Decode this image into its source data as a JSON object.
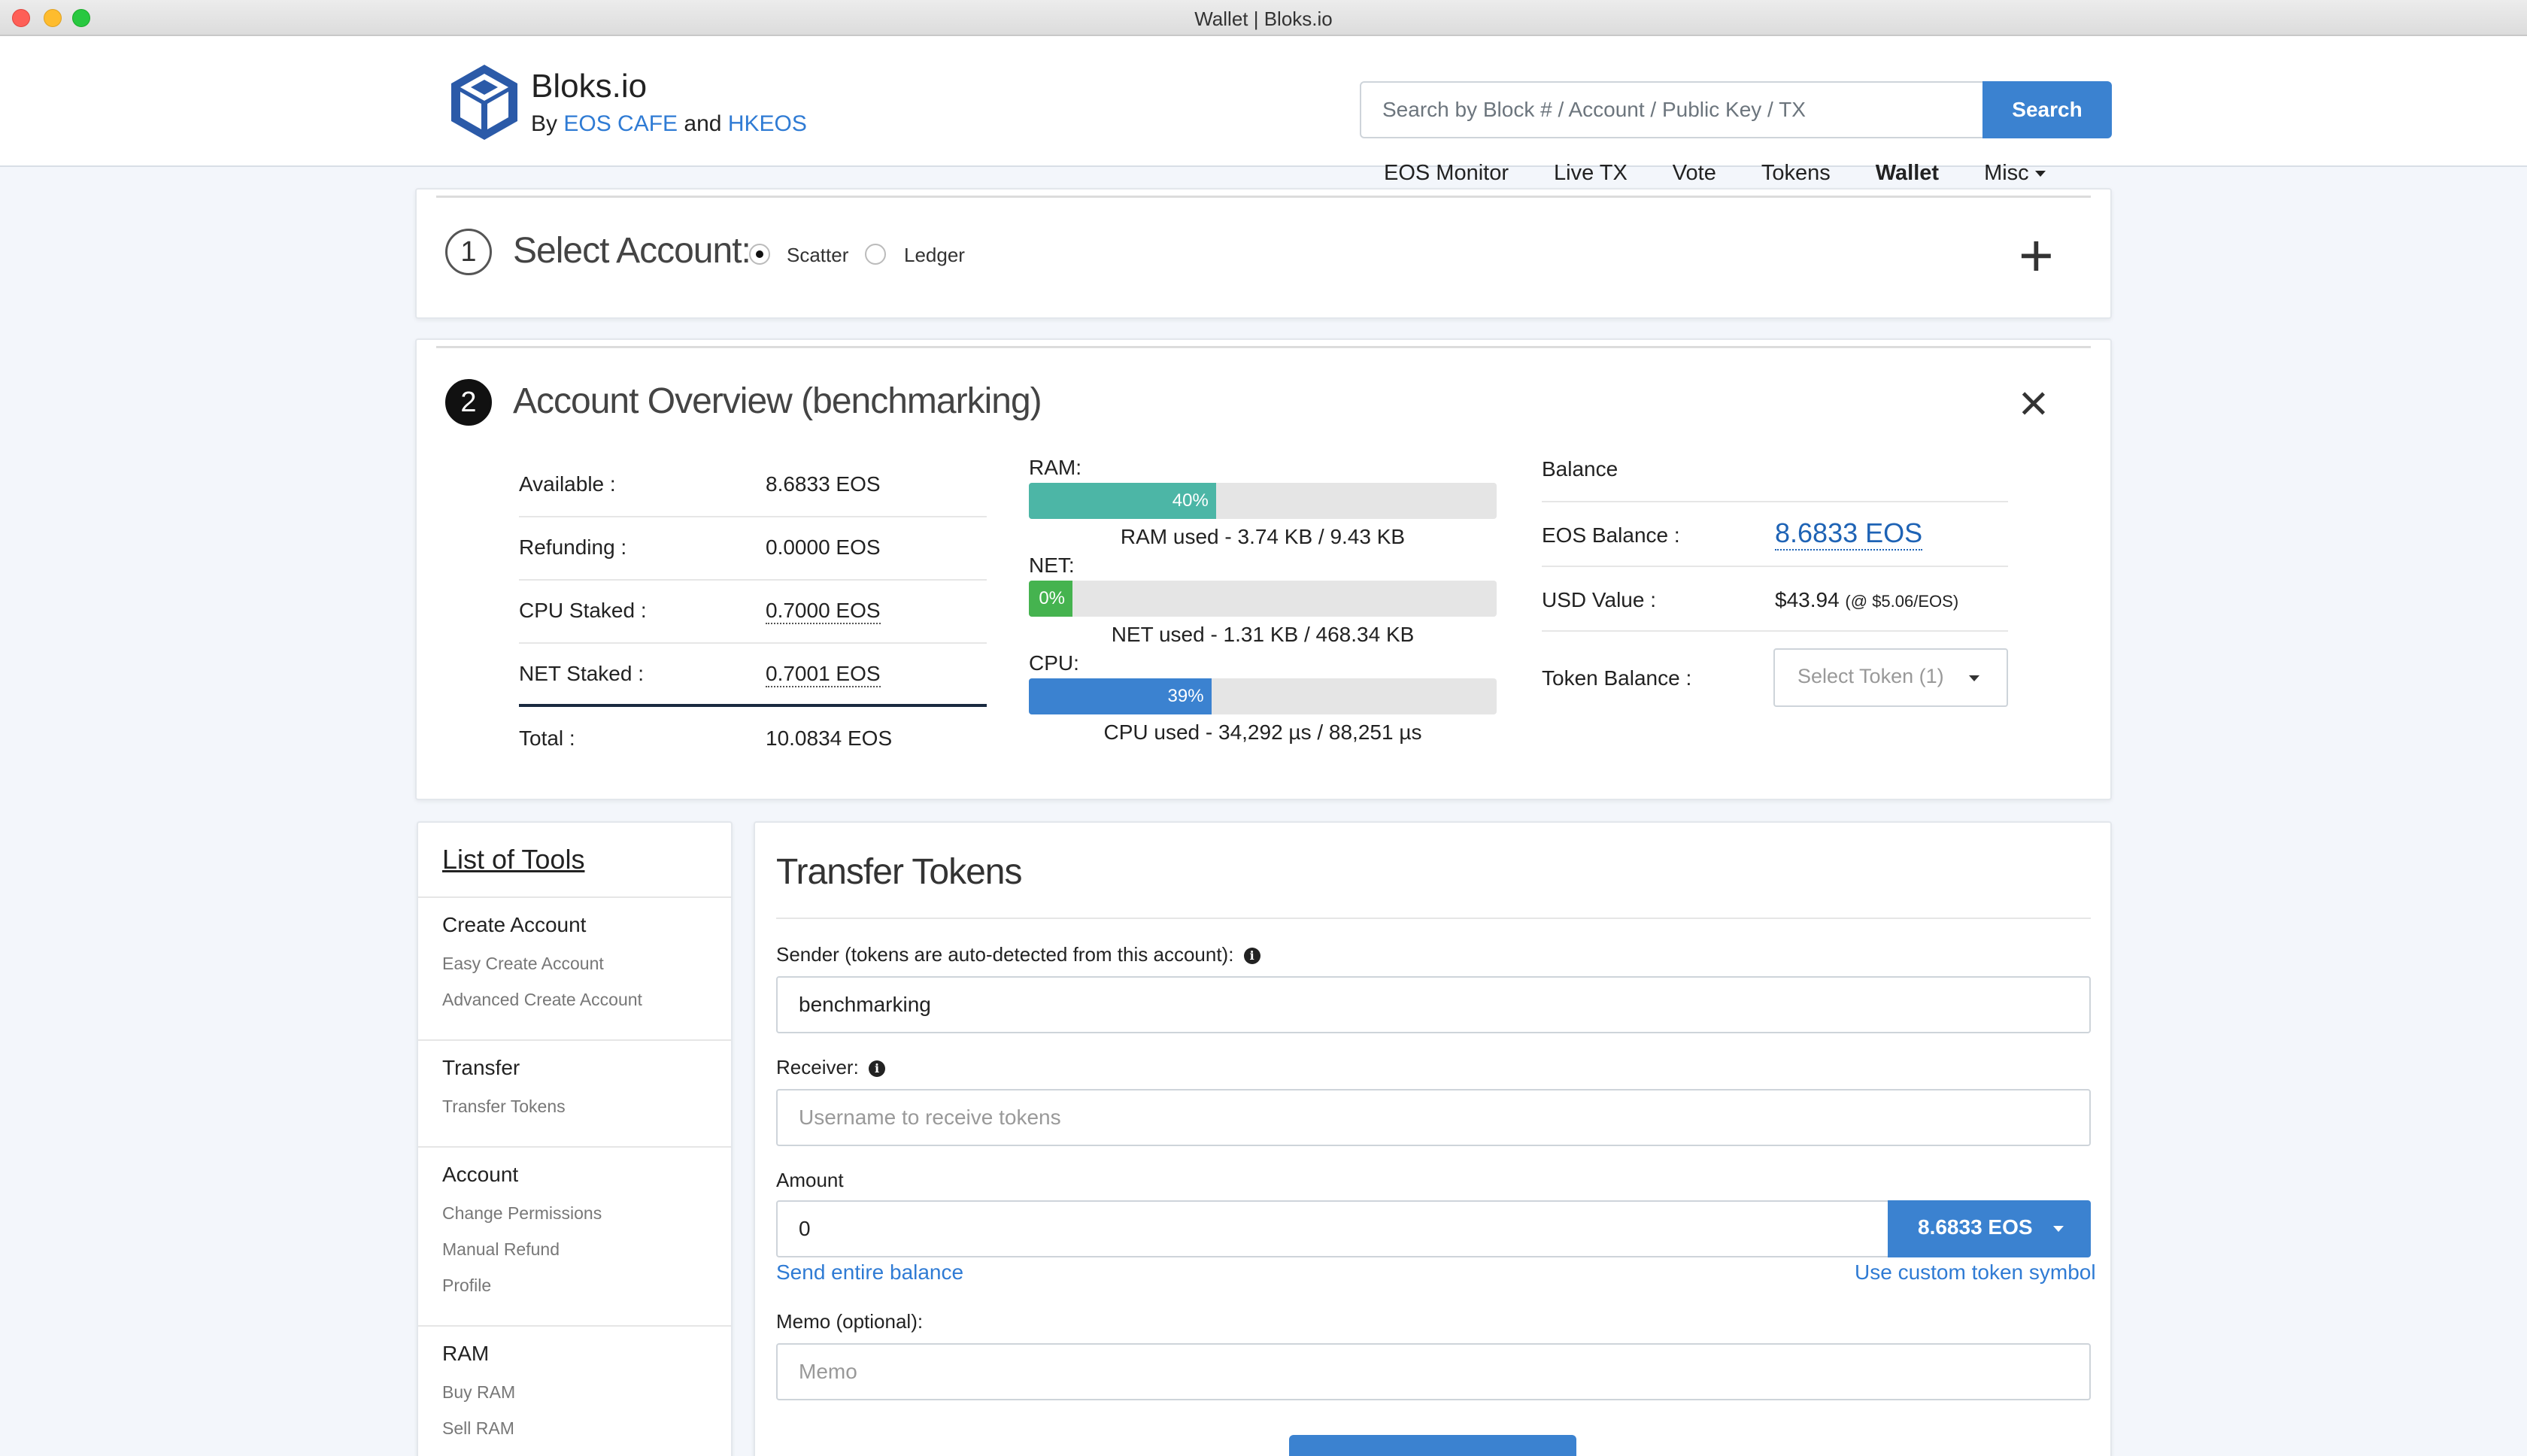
{
  "window": {
    "title": "Wallet | Bloks.io"
  },
  "header": {
    "brand": "Bloks.io",
    "by": "By",
    "sponsor1": "EOS CAFE",
    "and": "and",
    "sponsor2": "HKEOS",
    "search_placeholder": "Search by Block # / Account / Public Key / TX",
    "search_button": "Search",
    "nav": [
      "EOS Monitor",
      "Live TX",
      "Vote",
      "Tokens",
      "Wallet",
      "Misc"
    ],
    "active_nav": "Wallet"
  },
  "select_account": {
    "step": "1",
    "title": "Select Account:",
    "options": [
      "Scatter",
      "Ledger"
    ],
    "selected": "Scatter",
    "add_icon": "plus-icon"
  },
  "overview": {
    "step": "2",
    "title": "Account Overview (benchmarking)",
    "close_icon": "close-icon",
    "stats": [
      {
        "label": "Available :",
        "value": "8.6833 EOS"
      },
      {
        "label": "Refunding :",
        "value": "0.0000 EOS"
      },
      {
        "label": "CPU Staked :",
        "value": "0.7000 EOS"
      },
      {
        "label": "NET Staked :",
        "value": "0.7001 EOS"
      },
      {
        "label": "Total :",
        "value": "10.0834 EOS"
      }
    ],
    "resources": [
      {
        "label": "RAM:",
        "percent": 40,
        "percent_text": "40%",
        "color": "#4cb6a6",
        "caption": "RAM used - 3.74 KB / 9.43 KB"
      },
      {
        "label": "NET:",
        "percent": 0,
        "percent_text": "0%",
        "color": "#45b34f",
        "caption": "NET used - 1.31 KB / 468.34 KB"
      },
      {
        "label": "CPU:",
        "percent": 39,
        "percent_text": "39%",
        "color": "#3b82d0",
        "caption": "CPU used - 34,292 µs / 88,251 µs"
      }
    ],
    "balance": {
      "heading": "Balance",
      "eos_label": "EOS Balance :",
      "eos_value": "8.6833 EOS",
      "usd_label": "USD Value :",
      "usd_value": "$43.94",
      "usd_rate": "(@ $5.06/EOS)",
      "token_label": "Token Balance :",
      "token_select": "Select Token (1)"
    }
  },
  "tools": {
    "title": "List of Tools",
    "groups": [
      {
        "name": "Create Account",
        "items": [
          "Easy Create Account",
          "Advanced Create Account"
        ]
      },
      {
        "name": "Transfer",
        "items": [
          "Transfer Tokens"
        ]
      },
      {
        "name": "Account",
        "items": [
          "Change Permissions",
          "Manual Refund",
          "Profile"
        ]
      },
      {
        "name": "RAM",
        "items": [
          "Buy RAM",
          "Sell RAM"
        ]
      }
    ]
  },
  "transfer": {
    "title": "Transfer Tokens",
    "sender_label": "Sender (tokens are auto-detected from this account):",
    "sender_value": "benchmarking",
    "receiver_label": "Receiver:",
    "receiver_placeholder": "Username to receive tokens",
    "amount_label": "Amount",
    "amount_value": "0",
    "amount_token": "8.6833 EOS",
    "send_all": "Send entire balance",
    "custom_symbol": "Use custom token symbol",
    "memo_label": "Memo (optional):",
    "memo_placeholder": "Memo"
  }
}
